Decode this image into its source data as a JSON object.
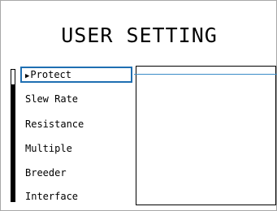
{
  "title": "USER SETTING",
  "menu": {
    "items": [
      {
        "label": "Protect",
        "selected": true
      },
      {
        "label": "Slew Rate",
        "selected": false
      },
      {
        "label": "Resistance",
        "selected": false
      },
      {
        "label": "Multiple",
        "selected": false
      },
      {
        "label": "Breeder",
        "selected": false
      },
      {
        "label": "Interface",
        "selected": false
      }
    ],
    "selected_marker": "▶"
  },
  "colors": {
    "selection_border": "#1f6fb2",
    "connector_line": "#3a8cc8",
    "text": "#000000",
    "background": "#ffffff"
  }
}
